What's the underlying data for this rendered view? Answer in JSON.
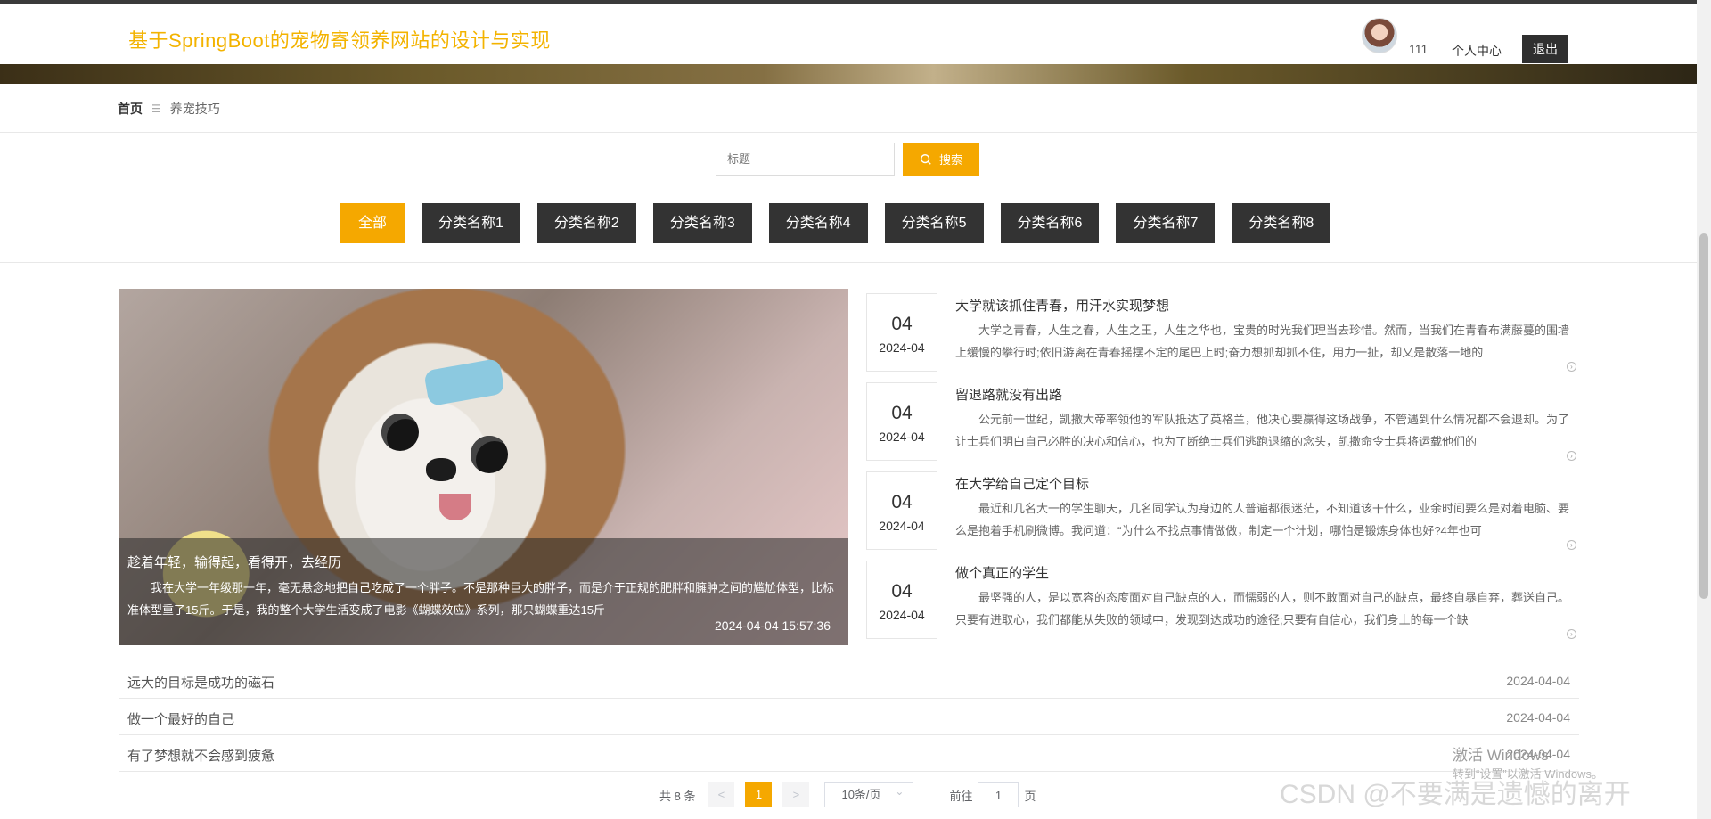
{
  "header": {
    "site_title": "基于SpringBoot的宠物寄领养网站的设计与实现",
    "user_name": "111",
    "user_center": "个人中心",
    "logout": "退出"
  },
  "breadcrumb": {
    "home": "首页",
    "separator": "☰",
    "current": "养宠技巧"
  },
  "search": {
    "placeholder": "标题",
    "button": "搜索"
  },
  "categories": [
    "全部",
    "分类名称1",
    "分类名称2",
    "分类名称3",
    "分类名称4",
    "分类名称5",
    "分类名称6",
    "分类名称7",
    "分类名称8"
  ],
  "featured": {
    "title": "趁着年轻，输得起，看得开，去经历",
    "desc": "我在大学一年级那一年，毫无悬念地把自己吃成了一个胖子。不是那种巨大的胖子，而是介于正规的肥胖和臃肿之间的尴尬体型，比标准体型重了15斤。于是，我的整个大学生活变成了电影《蝴蝶效应》系列，那只蝴蝶重达15斤",
    "time": "2024-04-04 15:57:36"
  },
  "news": [
    {
      "day": "04",
      "date": "2024-04",
      "title": "大学就该抓住青春，用汗水实现梦想",
      "desc": "大学之青春，人生之春，人生之王，人生之华也，宝贵的时光我们理当去珍惜。然而，当我们在青春布满藤蔓的围墙上缓慢的攀行时;依旧游离在青春摇摆不定的尾巴上时;奋力想抓却抓不住，用力一扯，却又是散落一地的"
    },
    {
      "day": "04",
      "date": "2024-04",
      "title": "留退路就没有出路",
      "desc": "公元前一世纪，凯撒大帝率领他的军队抵达了英格兰，他决心要赢得这场战争，不管遇到什么情况都不会退却。为了让士兵们明白自己必胜的决心和信心，也为了断绝士兵们逃跑退缩的念头，凯撒命令士兵将运载他们的"
    },
    {
      "day": "04",
      "date": "2024-04",
      "title": "在大学给自己定个目标",
      "desc": "最近和几名大一的学生聊天，几名同学认为身边的人普遍都很迷茫，不知道该干什么，业余时间要么是对着电脑、要么是抱着手机刷微博。我问道：“为什么不找点事情做做，制定一个计划，哪怕是锻炼身体也好?4年也可"
    },
    {
      "day": "04",
      "date": "2024-04",
      "title": "做个真正的学生",
      "desc": "最坚强的人，是以宽容的态度面对自己缺点的人，而懦弱的人，则不敢面对自己的缺点，最终自暴自弃，葬送自己。只要有进取心，我们都能从失败的领域中，发现到达成功的途径;只要有自信心，我们身上的每一个缺"
    }
  ],
  "simple_list": [
    {
      "title": "远大的目标是成功的磁石",
      "date": "2024-04-04"
    },
    {
      "title": "做一个最好的自己",
      "date": "2024-04-04"
    },
    {
      "title": "有了梦想就不会感到疲惫",
      "date": "2024-04-04"
    }
  ],
  "pagination": {
    "total": "共 8 条",
    "prev": "<",
    "current": "1",
    "next": ">",
    "page_size": "10条/页",
    "goto": "前往",
    "goto_value": "1",
    "page_unit": "页"
  },
  "watermarks": {
    "activate": "激活 Windows",
    "activate_sub": "转到“设置”以激活 Windows。",
    "csdn": "CSDN @不要满是遗憾的离开"
  },
  "colors": {
    "accent": "#f5a800",
    "title": "#f3b300",
    "dark": "#333333"
  }
}
